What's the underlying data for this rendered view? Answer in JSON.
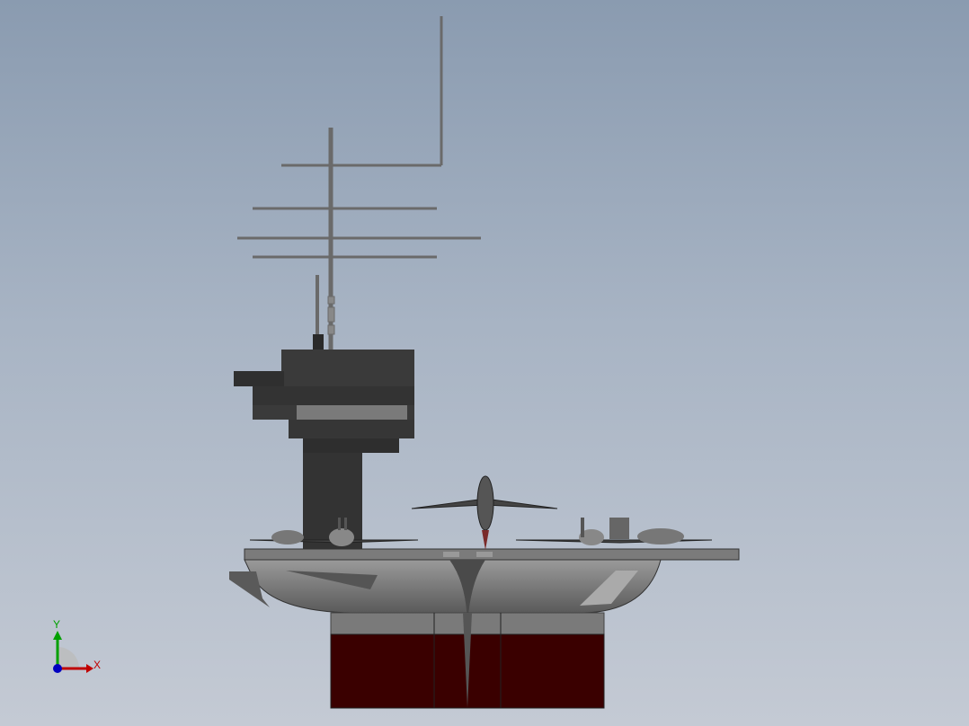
{
  "viewport": {
    "background_top": "#8a9bb0",
    "background_bottom": "#c4cad4",
    "model": "aircraft-carrier"
  },
  "triad": {
    "x_label": "X",
    "y_label": "Y",
    "x_color": "#c00000",
    "y_color": "#00a000",
    "z_color": "#0000c0"
  },
  "colors": {
    "superstructure": "#3a3a3a",
    "hull": "#6e6e6e",
    "hull_light": "#8a8a8a",
    "waterline": "#3a0000",
    "mast": "#777777"
  }
}
